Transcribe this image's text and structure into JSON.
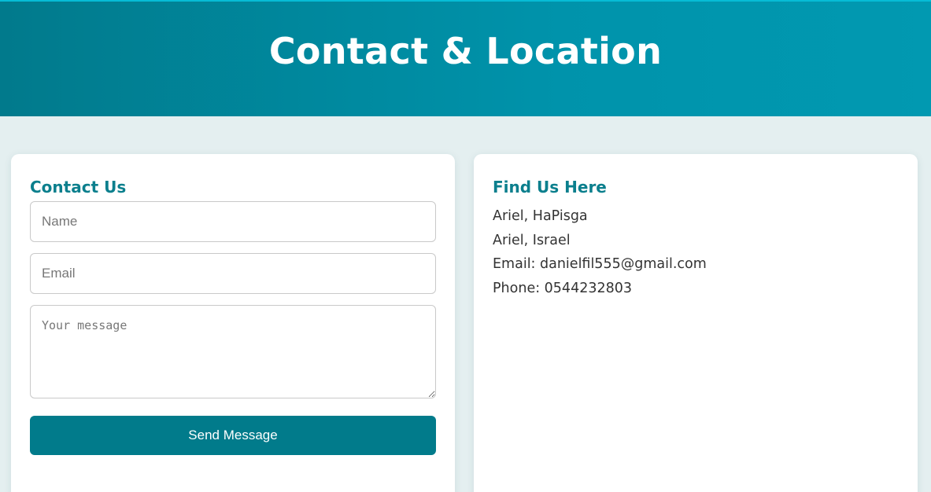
{
  "header": {
    "title": "Contact & Location"
  },
  "contact_form": {
    "title": "Contact Us",
    "name_placeholder": "Name",
    "email_placeholder": "Email",
    "message_placeholder": "Your message",
    "submit_label": "Send Message"
  },
  "location": {
    "title": "Find Us Here",
    "lines": [
      "Ariel, HaPisga",
      "Ariel, Israel",
      "Email: danielfil555@gmail.com",
      "Phone: 0544232803"
    ]
  },
  "colors": {
    "header_start": "#017a8c",
    "header_end": "#0199b1",
    "accent": "#0b7f8d",
    "button": "#017b8b",
    "page_background": "#e4eff0"
  }
}
